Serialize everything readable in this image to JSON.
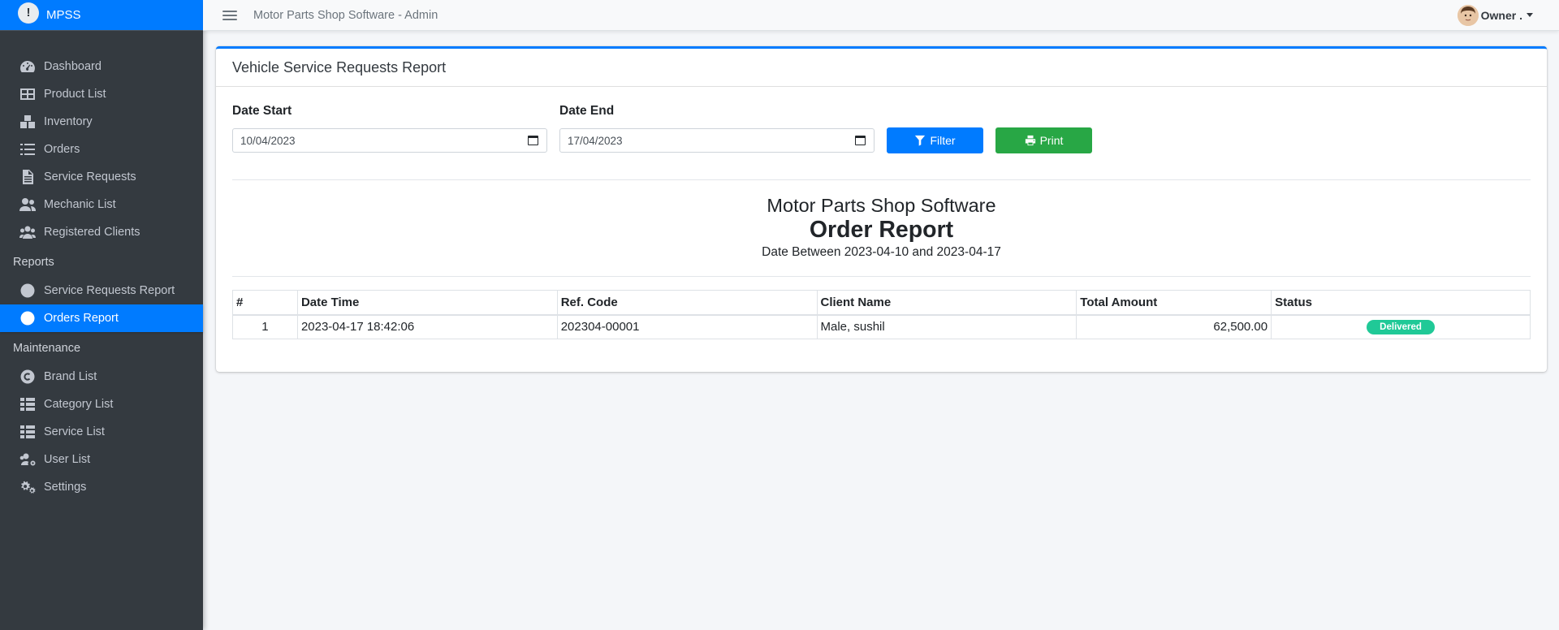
{
  "app": {
    "brand": "MPSS",
    "brand_logo_glyph": "!",
    "topbar_title": "Motor Parts Shop Software - Admin",
    "user_label": "Owner ."
  },
  "sidebar": {
    "items": [
      {
        "label": "Dashboard",
        "icon": "dashboard-icon"
      },
      {
        "label": "Product List",
        "icon": "table-icon"
      },
      {
        "label": "Inventory",
        "icon": "boxes-icon"
      },
      {
        "label": "Orders",
        "icon": "list-icon"
      },
      {
        "label": "Service Requests",
        "icon": "file-icon"
      },
      {
        "label": "Mechanic List",
        "icon": "users-icon"
      },
      {
        "label": "Registered Clients",
        "icon": "users-group-icon"
      }
    ],
    "reports_header": "Reports",
    "reports": [
      {
        "label": "Service Requests Report",
        "icon": "circle-icon"
      },
      {
        "label": "Orders Report",
        "icon": "circle-icon",
        "active": true
      }
    ],
    "maintenance_header": "Maintenance",
    "maintenance": [
      {
        "label": "Brand List",
        "icon": "copyright-icon"
      },
      {
        "label": "Category List",
        "icon": "th-list-icon"
      },
      {
        "label": "Service List",
        "icon": "th-list-icon"
      },
      {
        "label": "User List",
        "icon": "users-cog-icon"
      },
      {
        "label": "Settings",
        "icon": "cogs-icon"
      }
    ]
  },
  "card": {
    "title": "Vehicle Service Requests Report",
    "date_start_label": "Date Start",
    "date_start_value": "10/04/2023",
    "date_end_label": "Date End",
    "date_end_value": "17/04/2023",
    "filter_label": "Filter",
    "print_label": "Print"
  },
  "report": {
    "company": "Motor Parts Shop Software",
    "title": "Order Report",
    "range": "Date Between 2023-04-10 and 2023-04-17",
    "columns": [
      "#",
      "Date Time",
      "Ref. Code",
      "Client Name",
      "Total Amount",
      "Status"
    ],
    "rows": [
      {
        "num": "1",
        "datetime": "2023-04-17 18:42:06",
        "ref": "202304-00001",
        "client": "Male, sushil",
        "amount": "62,500.00",
        "status": "Delivered"
      }
    ]
  },
  "colors": {
    "primary": "#007bff",
    "success": "#28a745",
    "sidebar_bg": "#343a40",
    "badge_delivered": "#20c997"
  }
}
